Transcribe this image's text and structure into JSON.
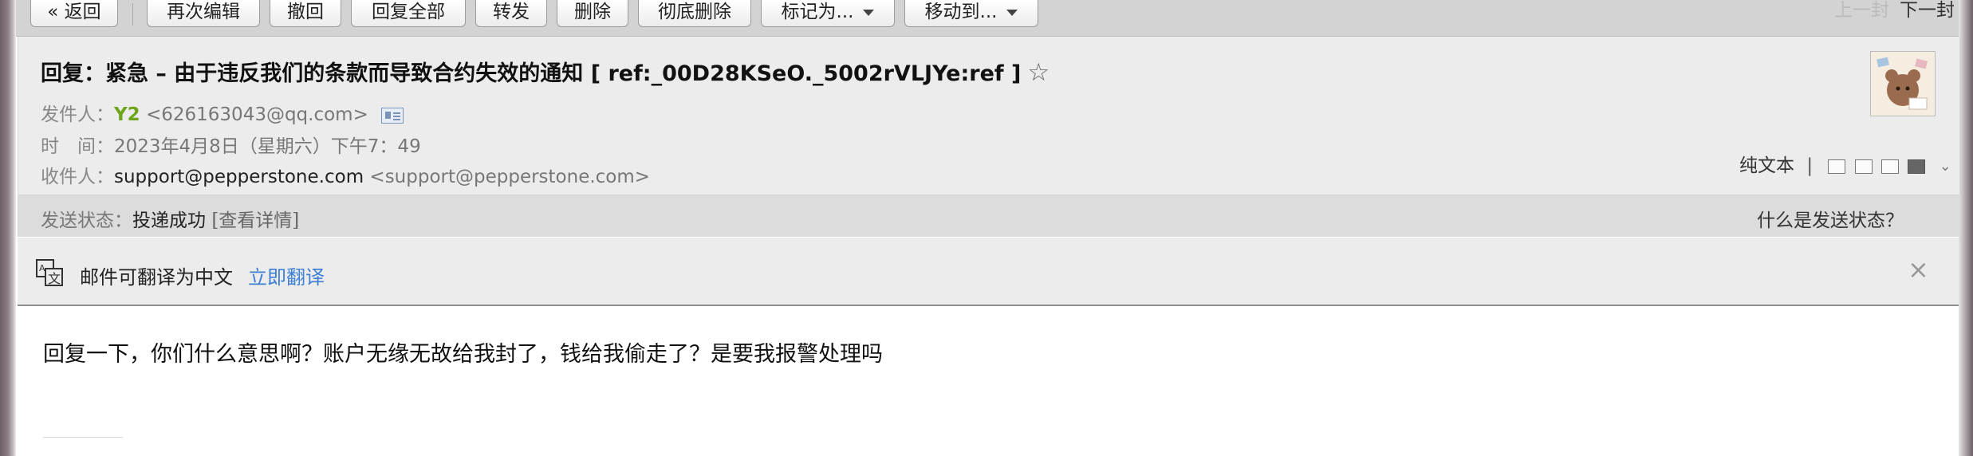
{
  "toolbar": {
    "buttons": [
      "« 返回",
      "再次编辑",
      "撤回",
      "回复全部",
      "转发",
      "删除",
      "彻底删除",
      "标记为...",
      "移动到..."
    ],
    "prev": "上一封",
    "next": "下一封"
  },
  "email": {
    "subject": "回复：紧急 – 由于违反我们的条款而导致合约失效的通知 [ ref:_00D28KSeO._5002rVLJYe:ref ]",
    "star": "☆",
    "from_label": "发件人：",
    "from_name": "Y2",
    "from_addr": "<626163043@qq.com>",
    "time_label": "时　间：",
    "time_value": "2023年4月8日（星期六）下午7：49",
    "to_label": "收件人：",
    "to_name": "support@pepperstone.com",
    "to_addr": "<support@pepperstone.com>",
    "plain_text": "纯文本",
    "body": "回复一下，你们什么意思啊？账户无缘无故给我封了，钱给我偷走了？是要我报警处理吗"
  },
  "status": {
    "label": "发送状态：",
    "value": "投递成功",
    "detail_link": "[查看详情]",
    "help": "什么是发送状态？"
  },
  "translate": {
    "text": "邮件可翻译为中文",
    "action": "立即翻译",
    "close": "×"
  },
  "colors": {
    "accent_link": "#3d7fd6",
    "sender_green": "#6fa51c"
  }
}
